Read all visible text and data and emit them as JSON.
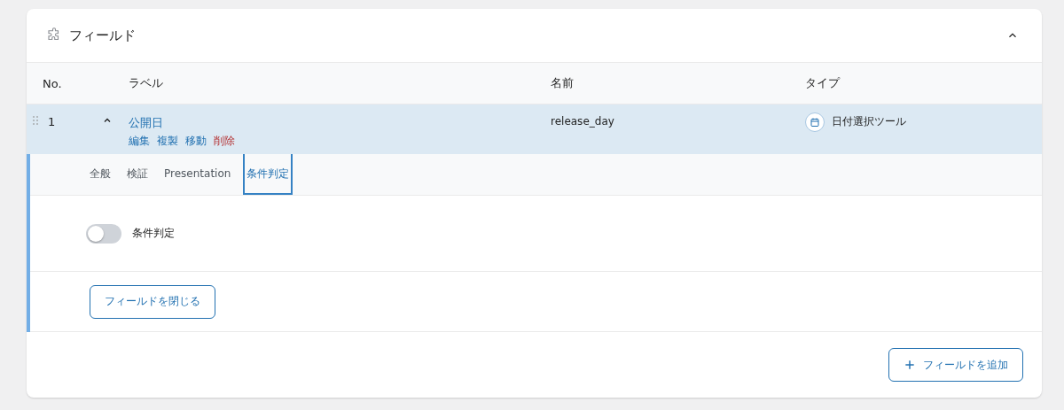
{
  "panel": {
    "title": "フィールド",
    "expanded": true
  },
  "table": {
    "columns": [
      "No.",
      "ラベル",
      "名前",
      "タイプ"
    ],
    "rows": [
      {
        "number": "1",
        "label": "公開日",
        "expanded": true,
        "actions": [
          {
            "label": "編集",
            "kind": "normal"
          },
          {
            "label": "複製",
            "kind": "normal"
          },
          {
            "label": "移動",
            "kind": "normal"
          },
          {
            "label": "削除",
            "kind": "danger"
          }
        ],
        "name": "release_day",
        "type": "日付選択ツール"
      }
    ]
  },
  "settings": {
    "tabs": [
      {
        "label": "全般",
        "selected": false
      },
      {
        "label": "検証",
        "selected": false
      },
      {
        "label": "Presentation",
        "selected": false
      },
      {
        "label": "条件判定",
        "selected": true
      }
    ],
    "toggle": {
      "label": "条件判定",
      "on": false
    },
    "close_button": "フィールドを閉じる"
  },
  "add_button": "フィールドを追加"
}
